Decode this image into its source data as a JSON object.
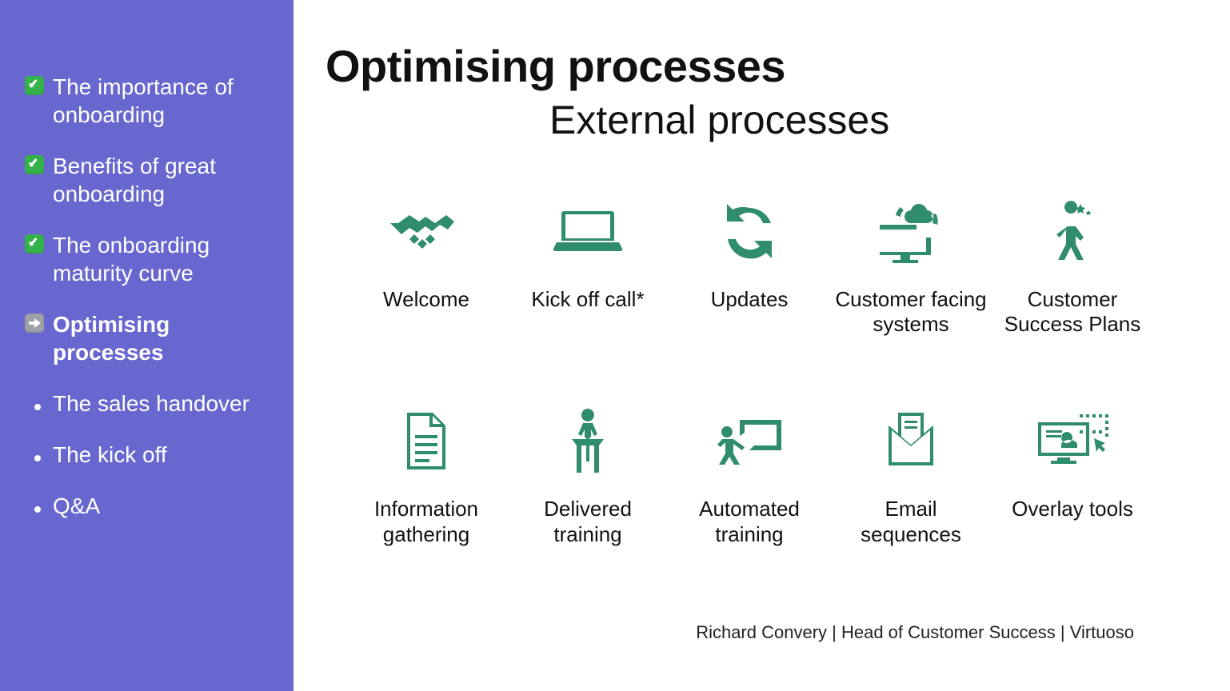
{
  "sidebar": {
    "items": [
      {
        "label": "The importance of onboarding",
        "state": "done"
      },
      {
        "label": "Benefits of great onboarding",
        "state": "done"
      },
      {
        "label": "The onboarding maturity curve",
        "state": "done"
      },
      {
        "label": "Optimising processes",
        "state": "current"
      },
      {
        "label": "The sales handover",
        "state": "pending"
      },
      {
        "label": "The kick off",
        "state": "pending"
      },
      {
        "label": "Q&A",
        "state": "pending"
      }
    ]
  },
  "main": {
    "title": "Optimising processes",
    "subtitle": "External processes",
    "processes": [
      {
        "icon": "handshake-icon",
        "label": "Welcome"
      },
      {
        "icon": "laptop-icon",
        "label": "Kick off call*"
      },
      {
        "icon": "refresh-icon",
        "label": "Updates"
      },
      {
        "icon": "monitor-cloud-icon",
        "label": "Customer facing systems"
      },
      {
        "icon": "star-person-icon",
        "label": "Customer Success Plans"
      },
      {
        "icon": "document-icon",
        "label": "Information gathering"
      },
      {
        "icon": "podium-icon",
        "label": "Delivered training"
      },
      {
        "icon": "teacher-board-icon",
        "label": "Automated training"
      },
      {
        "icon": "envelope-doc-icon",
        "label": "Email sequences"
      },
      {
        "icon": "overlay-screen-icon",
        "label": "Overlay tools"
      }
    ],
    "footer": "Richard Convery | Head of Customer Success | Virtuoso"
  },
  "colors": {
    "sidebar_bg": "#6867CF",
    "icon_green": "#2f8c6c",
    "check_green": "#36B24A"
  }
}
